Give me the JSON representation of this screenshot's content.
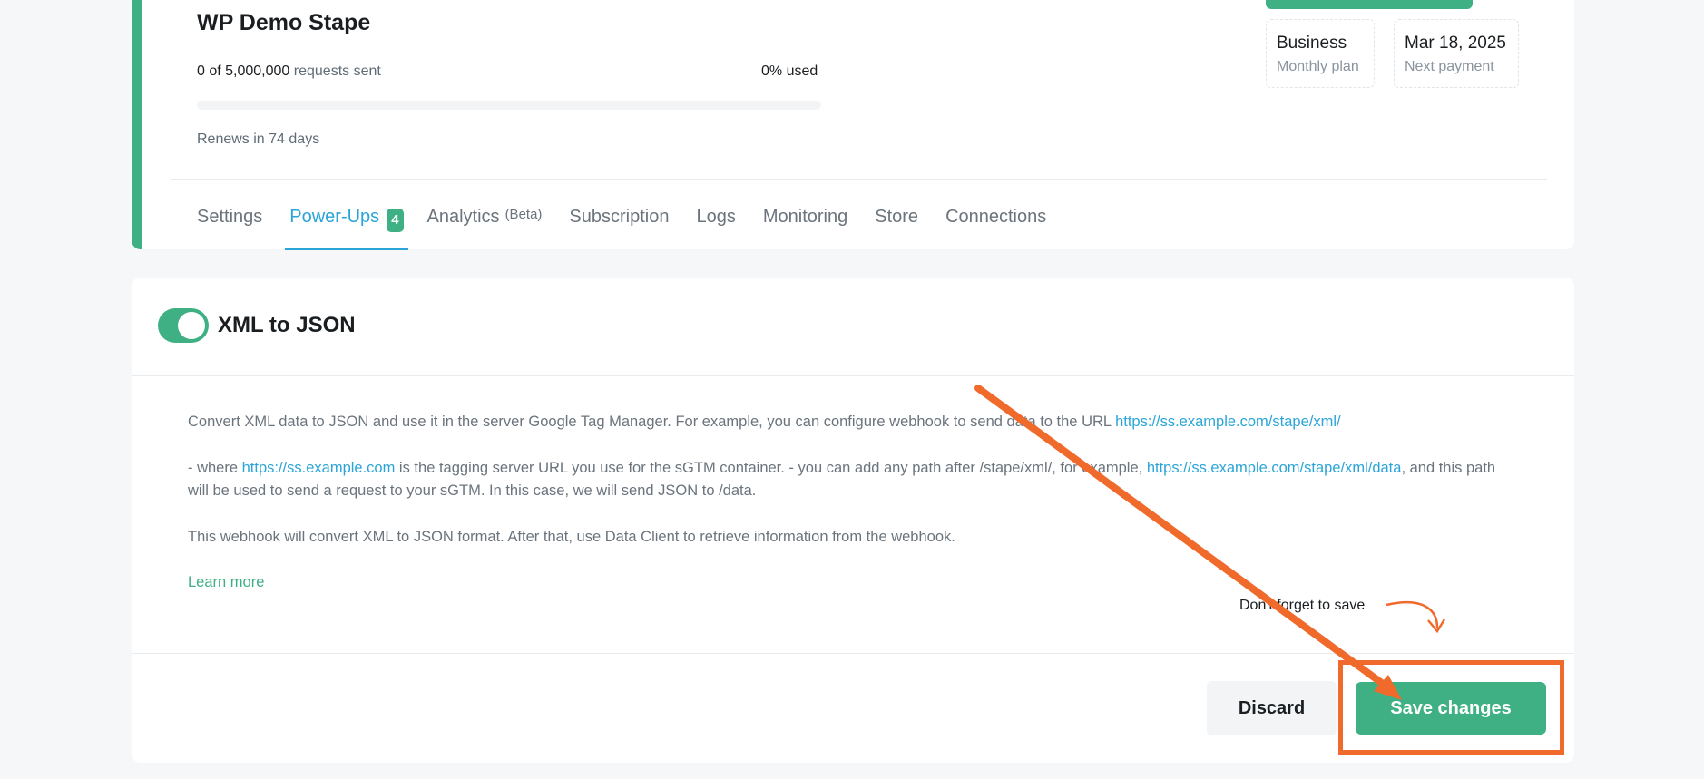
{
  "container": {
    "name": "WP Demo Stape",
    "requests_count": "0 of 5,000,000",
    "requests_suffix": "requests sent",
    "usage": "0% used",
    "usage_fraction": 0,
    "renews": "Renews in 74 days"
  },
  "plan": {
    "value": "Business",
    "label": "Monthly plan"
  },
  "payment": {
    "value": "Mar 18, 2025",
    "label": "Next payment"
  },
  "tabs": [
    {
      "label": "Settings"
    },
    {
      "label": "Power-Ups",
      "badge": "4"
    },
    {
      "label": "Analytics",
      "sup": "(Beta)"
    },
    {
      "label": "Subscription"
    },
    {
      "label": "Logs"
    },
    {
      "label": "Monitoring"
    },
    {
      "label": "Store"
    },
    {
      "label": "Connections"
    }
  ],
  "powerup": {
    "title": "XML to JSON",
    "enabled": true,
    "p1_text": "Convert XML data to JSON and use it in the server Google Tag Manager. For example, you can configure webhook to send data to the URL ",
    "p1_link": "https://ss.example.com/stape/xml/",
    "p2_a": "- where ",
    "p2_link1": "https://ss.example.com",
    "p2_b": " is the tagging server URL you use for the sGTM container. - you can add any path after /stape/xml/, for example, ",
    "p2_link2": "https://ss.example.com/stape/xml/data",
    "p2_c": ", and this path will be used to send a request to your sGTM. In this case, we will send JSON to /data.",
    "p3_text": "This webhook will convert XML to JSON format. After that, use Data Client to retrieve information from the webhook.",
    "learn_more": "Learn more"
  },
  "annotation": {
    "note": "Don't forget to save",
    "color": "#f06a2c"
  },
  "actions": {
    "discard": "Discard",
    "save": "Save changes"
  },
  "colors": {
    "brand_green": "#3fb084",
    "link_blue": "#2ba5d8",
    "annotation_orange": "#f06a2c"
  }
}
